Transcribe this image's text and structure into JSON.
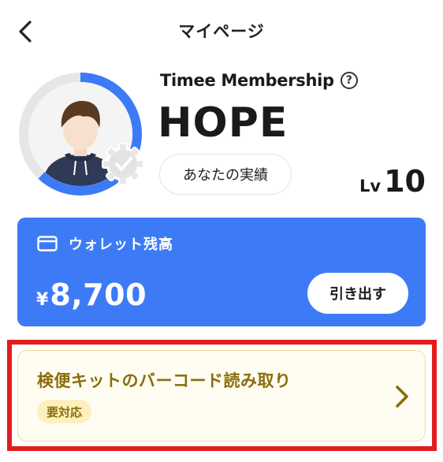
{
  "header": {
    "title": "マイページ",
    "back_icon": "chevron-left-icon"
  },
  "profile": {
    "membership_label": "Timee Membership",
    "help_icon_glyph": "?",
    "rank_name": "HOPE",
    "achievements_label": "あなたの実績",
    "level_prefix": "Lv",
    "level_value": "10",
    "level_progress": 0.62,
    "ring_color": "#3d7bf6"
  },
  "wallet": {
    "title": "ウォレット残高",
    "currency": "¥",
    "amount": "8,700",
    "withdraw_label": "引き出す",
    "color": "#3d7bf6",
    "icon": "card-icon"
  },
  "task": {
    "title": "検便キットのバーコード読み取り",
    "badge": "要対応",
    "arrow_icon": "chevron-right-icon",
    "accent_color": "#8a6d0b"
  }
}
